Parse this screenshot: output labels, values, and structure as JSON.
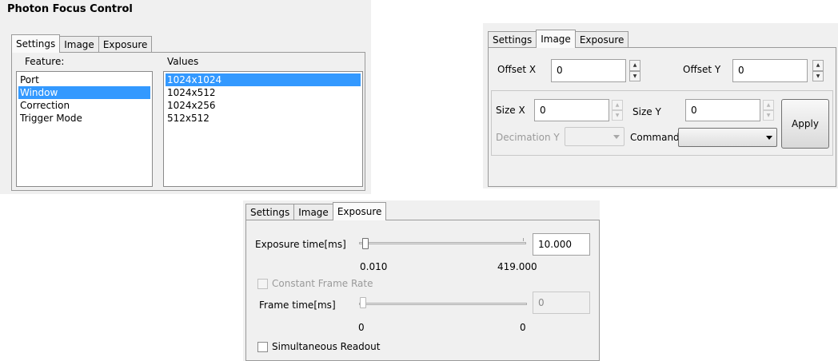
{
  "window_title": "Photon Focus Control",
  "tabs": [
    "Settings",
    "Image",
    "Exposure"
  ],
  "settings": {
    "feature_label": "Feature:",
    "values_label": "Values",
    "features": [
      "Port",
      "Window",
      "Correction",
      "Trigger Mode"
    ],
    "selected_feature": "Window",
    "values": [
      "1024x1024",
      "1024x512",
      "1024x256",
      "512x512"
    ],
    "selected_value": "1024x1024"
  },
  "image": {
    "offset_x_label": "Offset X",
    "offset_x_value": "0",
    "offset_y_label": "Offset Y",
    "offset_y_value": "0",
    "size_x_label": "Size X",
    "size_x_value": "0",
    "size_y_label": "Size Y",
    "size_y_value": "0",
    "decimation_y_label": "Decimation Y",
    "decimation_y_value": "",
    "command_label": "Command",
    "command_value": "",
    "apply_label": "Apply"
  },
  "exposure": {
    "exposure_label": "Exposure time[ms]",
    "exposure_value": "10.000",
    "exposure_min": "0.010",
    "exposure_max": "419.000",
    "exposure_fraction": 0.0,
    "constant_frame_rate_label": "Constant Frame Rate",
    "constant_frame_rate_checked": false,
    "frame_label": "Frame time[ms]",
    "frame_value": "0",
    "frame_min": "0",
    "frame_max": "0",
    "simultaneous_readout_label": "Simultaneous Readout",
    "simultaneous_readout_checked": false
  },
  "colors": {
    "selection": "#3399ff",
    "panel": "#f0f0f0"
  }
}
